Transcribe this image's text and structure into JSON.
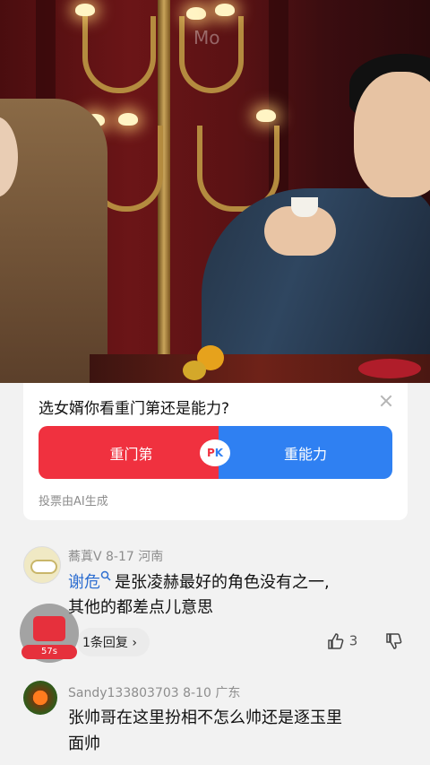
{
  "video": {
    "watermark": "Mo"
  },
  "poll": {
    "question": "选女婿你看重门第还是能力?",
    "option_left": "重门第",
    "option_right": "重能力",
    "vs_p": "P",
    "vs_k": "K",
    "note": "投票由AI生成"
  },
  "comments": [
    {
      "user": "蕎蒖V  8-17  河南",
      "mention": "谢危",
      "text_line1": "是张凌赫最好的角色没有之一,",
      "text_line2": "其他的都差点儿意思",
      "replies": "1条回复 ›",
      "likes": "3"
    },
    {
      "user": "Sandy133803703  8-10  广东",
      "text_line1": "张帅哥在这里扮相不怎么帅还是逐玉里",
      "text_line2": "面帅"
    }
  ],
  "float_ad": {
    "timer": "57s"
  },
  "colors": {
    "red": "#f0313f",
    "blue": "#2f80f2"
  }
}
